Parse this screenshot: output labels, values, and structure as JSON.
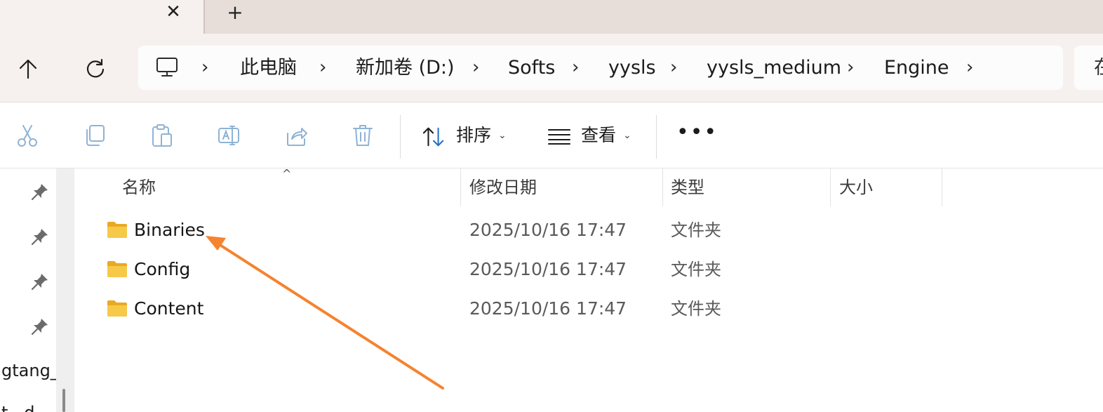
{
  "tabs": {
    "close_glyph": "✕",
    "new_glyph": "+"
  },
  "address": {
    "crumbs": [
      "此电脑",
      "新加卷 (D:)",
      "Softs",
      "yysls",
      "yysls_medium",
      "Engine"
    ],
    "search_partial": "在"
  },
  "toolbar": {
    "sort_label": "排序",
    "view_label": "查看",
    "more_glyph": "•••",
    "caret": "⌄",
    "icons": [
      "cut-icon",
      "copy-icon",
      "paste-icon",
      "rename-icon",
      "share-icon",
      "delete-icon",
      "sort-icon",
      "view-icon"
    ]
  },
  "leftpane": {
    "partial_items": [
      "gtang_",
      "t...d"
    ]
  },
  "columns": {
    "name": "名称",
    "modified": "修改日期",
    "type": "类型",
    "size": "大小",
    "sort_caret": "^"
  },
  "files": [
    {
      "name": "Binaries",
      "modified": "2025/10/16 17:47",
      "type": "文件夹"
    },
    {
      "name": "Config",
      "modified": "2025/10/16 17:47",
      "type": "文件夹"
    },
    {
      "name": "Content",
      "modified": "2025/10/16 17:47",
      "type": "文件夹"
    }
  ],
  "colors": {
    "annotation_arrow": "#f5832f",
    "folder": "#f7c948",
    "toolbar_disabled": "#8fb3d4"
  }
}
